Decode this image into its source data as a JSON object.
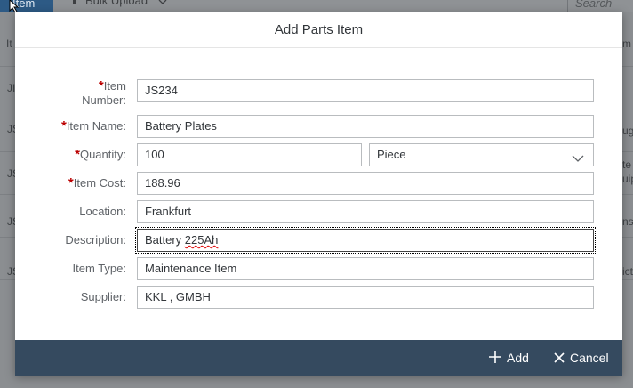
{
  "background": {
    "active_button": "Item",
    "bulk_upload": "Bulk Upload",
    "search_placeholder": "Search",
    "column_left": "It",
    "column_right": "m",
    "row_left": [
      "JI",
      "JS",
      "JS",
      "JS",
      "JS"
    ],
    "row_right": [
      "ug",
      "te",
      "uip",
      "nse",
      "ict"
    ]
  },
  "dialog": {
    "title": "Add Parts Item",
    "fields": {
      "item_number": {
        "label": "Item Number:",
        "required": "*",
        "value": "JS234"
      },
      "item_name": {
        "label": "Item Name:",
        "required": "*",
        "value": "Battery Plates"
      },
      "quantity": {
        "label": "Quantity:",
        "required": "*",
        "value": "100",
        "unit": "Piece"
      },
      "item_cost": {
        "label": "Item Cost:",
        "required": "*",
        "value": "188.96"
      },
      "location": {
        "label": "Location:",
        "value": "Frankfurt"
      },
      "description": {
        "label": "Description:",
        "value_word1": "Battery ",
        "value_word2": "225Ah"
      },
      "item_type": {
        "label": "Item Type:",
        "value": "Maintenance Item"
      },
      "supplier": {
        "label": "Supplier:",
        "value": "KKL , GMBH"
      }
    },
    "footer": {
      "add_label": "Add",
      "cancel_label": "Cancel"
    }
  }
}
